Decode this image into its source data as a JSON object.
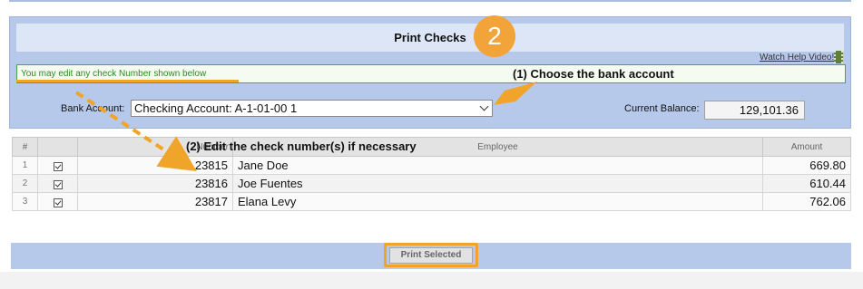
{
  "window": {
    "title": "Print Checks",
    "help_link": "Watch Help Video!",
    "info_message": "You may edit any check Number shown below"
  },
  "form": {
    "bank_account_label": "Bank Account:",
    "bank_account_value": "Checking Account: A-1-01-00 1",
    "current_balance_label": "Current Balance:",
    "current_balance_value": "129,101.36"
  },
  "table": {
    "headers": [
      "#",
      "",
      "Number",
      "Employee",
      "Amount"
    ],
    "rows": [
      {
        "index": "1",
        "checked": true,
        "number": "23815",
        "employee": "Jane Doe",
        "amount": "669.80"
      },
      {
        "index": "2",
        "checked": true,
        "number": "23816",
        "employee": "Joe Fuentes",
        "amount": "610.44"
      },
      {
        "index": "3",
        "checked": true,
        "number": "23817",
        "employee": "Elana Levy",
        "amount": "762.06"
      }
    ]
  },
  "actions": {
    "print_selected_label": "Print Selected"
  },
  "annotations": {
    "step_badge": "2",
    "callout_1": "(1) Choose the bank account",
    "callout_2": "(2) Edit the check number(s) if necessary"
  },
  "colors": {
    "panel_blue": "#b6c9ea",
    "title_bar": "#dce6f7",
    "annotation_orange": "#f0a52a",
    "info_green": "#2a8a20"
  },
  "icons": {
    "help_video": "film-icon",
    "select_chevron": "chevron-down-icon",
    "row_checkbox": "checkbox-checked-icon"
  }
}
